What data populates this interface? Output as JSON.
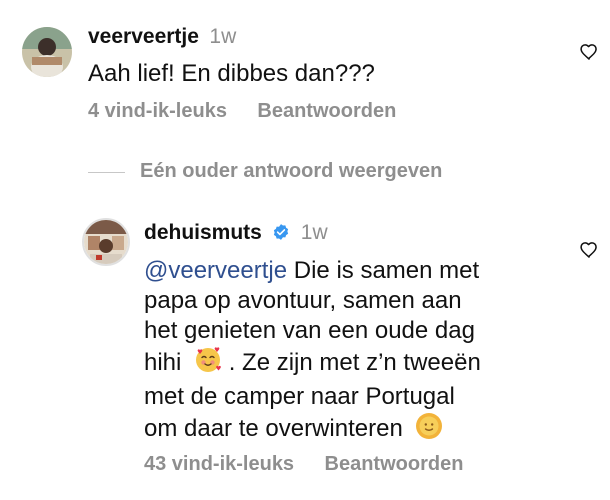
{
  "comments": [
    {
      "username": "veerveertje",
      "time": "1w",
      "text": "Aah lief! En dibbes dan???",
      "likes": "4 vind-ik-leuks",
      "reply_label": "Beantwoorden",
      "avatar_icon": "user-avatar-photo",
      "like_icon": "heart-outline-icon"
    },
    {
      "username": "dehuismuts",
      "verified": true,
      "time": "1w",
      "mention": "@veerveertje",
      "text_lines": [
        "Die is samen met",
        "papa op avontuur, samen aan",
        "het genieten van een oude dag",
        "hihi",
        ". Ze zijn met z’n tweeën",
        "met de camper naar Portugal",
        "om daar te overwinteren"
      ],
      "likes": "43 vind-ik-leuks",
      "reply_label": "Beantwoorden",
      "avatar_icon": "user-avatar-photo",
      "like_icon": "heart-outline-icon",
      "emoji_1": "smiling-face-with-hearts-emoji",
      "emoji_2": "sun-with-face-emoji"
    }
  ],
  "view_replies_label": "Eén ouder antwoord weergeven",
  "colors": {
    "muted": "#8e8e8e",
    "mention": "#2f4f8f",
    "verified": "#3897f0"
  }
}
